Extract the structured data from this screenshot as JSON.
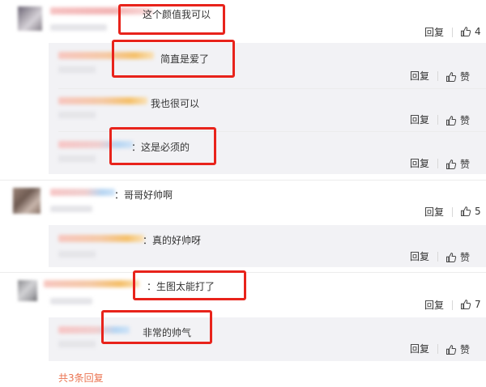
{
  "comments": [
    {
      "text": "这个颜值我可以",
      "reply_label": "回复",
      "like_count": "4",
      "replies": [
        {
          "text": "简直是爱了",
          "reply_label": "回复",
          "like_label": "赞"
        },
        {
          "text": "我也很可以",
          "reply_label": "回复",
          "like_label": "赞"
        },
        {
          "text": "：这是必须的",
          "reply_label": "回复",
          "like_label": "赞"
        }
      ]
    },
    {
      "text": "：哥哥好帅啊",
      "reply_label": "回复",
      "like_count": "5",
      "replies": [
        {
          "text": "：真的好帅呀",
          "reply_label": "回复",
          "like_label": "赞"
        }
      ]
    },
    {
      "text": "：生图太能打了",
      "reply_label": "回复",
      "like_count": "7",
      "replies": [
        {
          "text": "非常的帅气",
          "reply_label": "回复",
          "like_label": "赞"
        }
      ],
      "more_replies_label": "共3条回复"
    }
  ],
  "colors": {
    "highlight": "#e8231b",
    "more_link": "#eb7350",
    "reply_bg": "#f2f2f5"
  },
  "icons": {
    "like": "thumbs-up-icon"
  }
}
